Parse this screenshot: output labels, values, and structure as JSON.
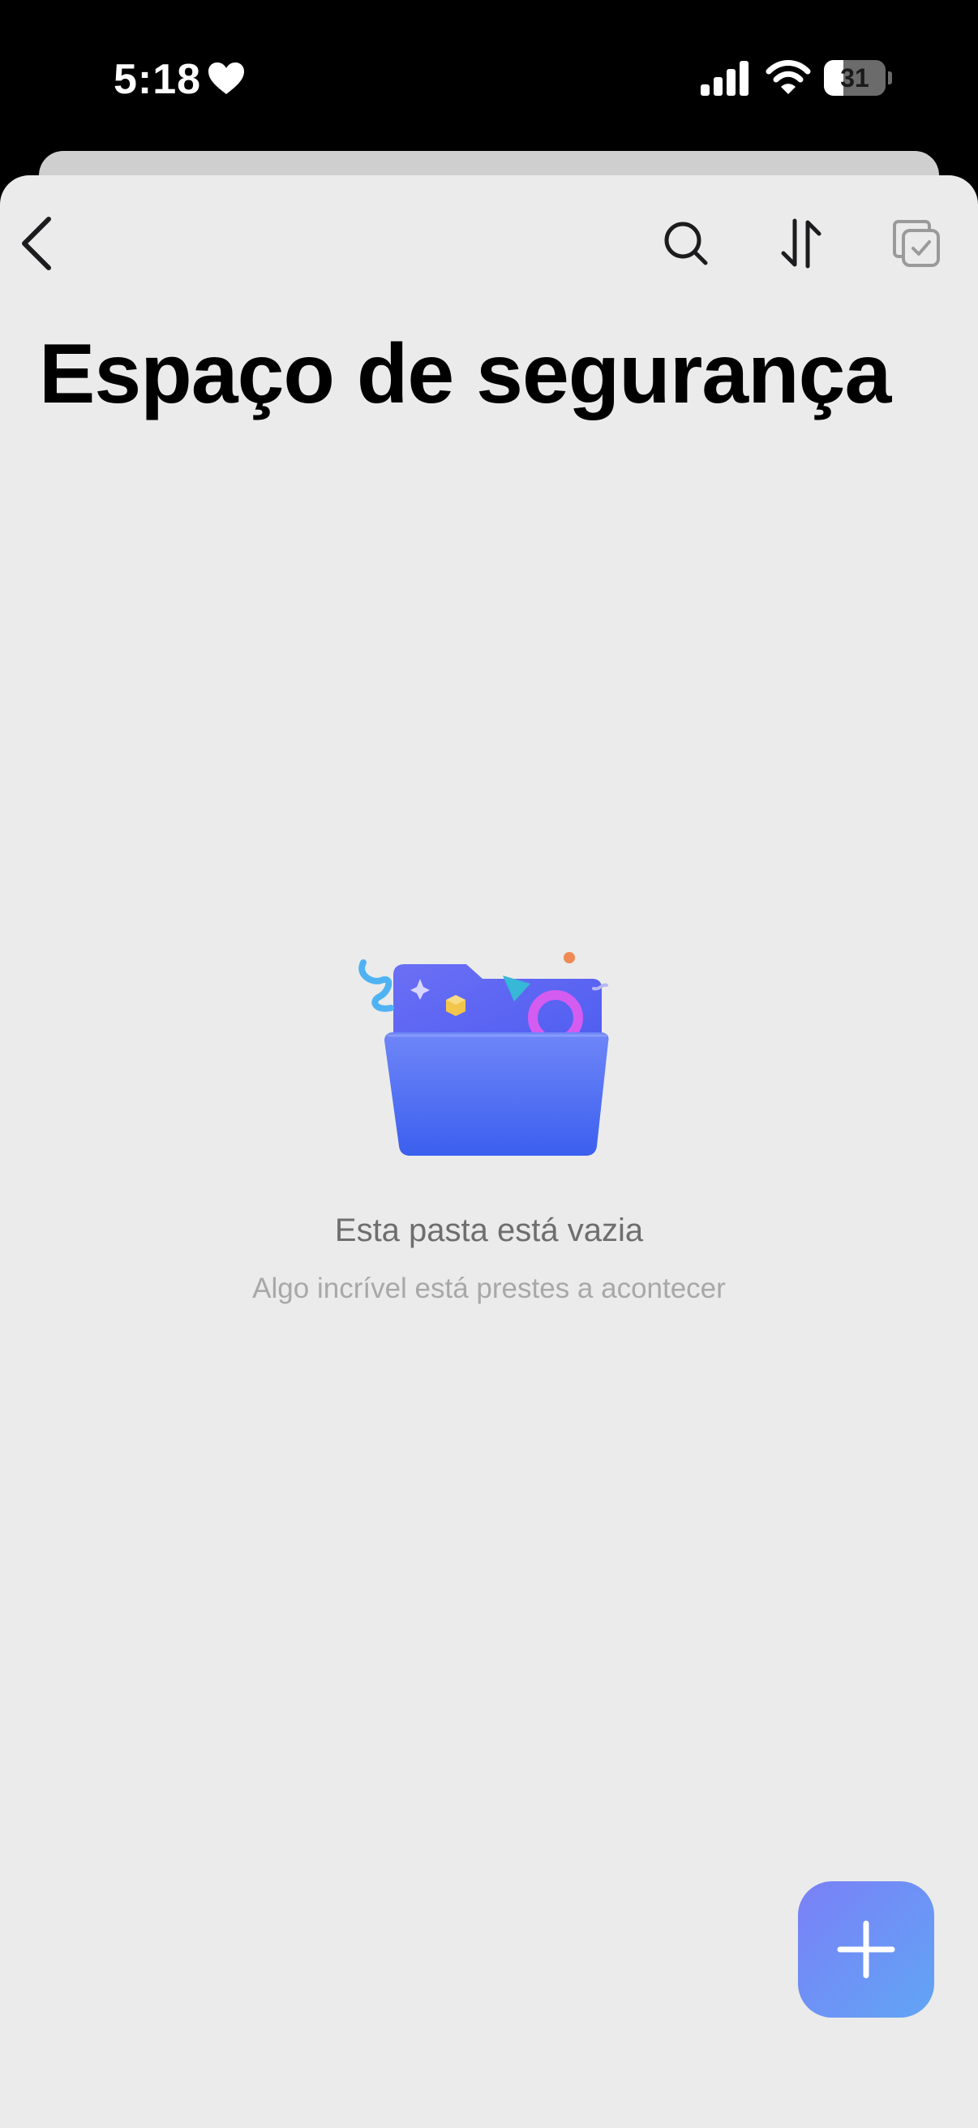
{
  "status_bar": {
    "time": "5:18",
    "battery_level": "31",
    "battery_fraction": 0.31,
    "icons": [
      "heart-icon",
      "cellular-signal-icon",
      "wifi-icon",
      "battery-icon"
    ]
  },
  "toolbar": {
    "icons": [
      "chevron-left-icon",
      "search-icon",
      "sort-icon",
      "multi-select-icon"
    ]
  },
  "page": {
    "title": "Espaço de segurança"
  },
  "empty_state": {
    "illustration": "empty-folder-illustration",
    "title": "Esta pasta está vazia",
    "subtitle": "Algo incrível está prestes a acontecer"
  },
  "fab": {
    "icon": "plus-icon"
  },
  "colors": {
    "sheet_background": "#ebebeb",
    "fab_gradient_start": "#7a80f6",
    "fab_gradient_end": "#61a5f5",
    "folder_blue": "#3f63f0"
  }
}
